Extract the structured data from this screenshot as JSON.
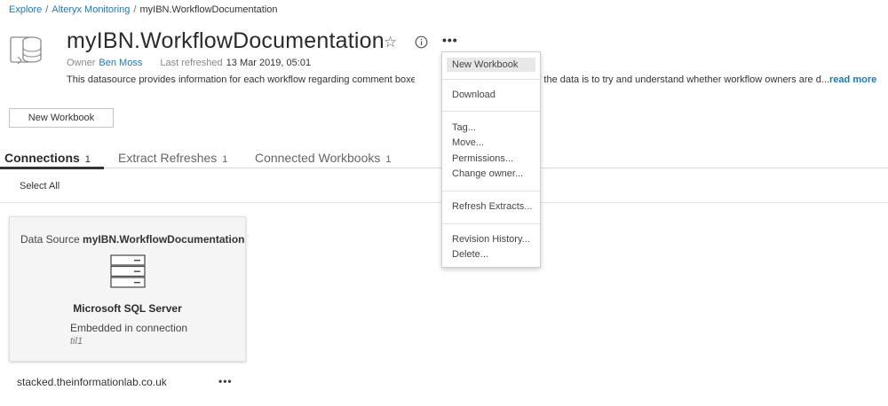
{
  "breadcrumb": {
    "items": [
      "Explore",
      "Alteryx Monitoring"
    ],
    "current": "myIBN.WorkflowDocumentation",
    "separator": "/"
  },
  "header": {
    "title": "myIBN.WorkflowDocumentation",
    "favorite_icon": "star-icon",
    "info_icon": "info-icon",
    "more_icon": "more-icon",
    "more_glyph": "•••",
    "owner_label": "Owner",
    "owner_name": "Ben Moss",
    "last_refreshed_label": "Last refreshed",
    "last_refreshed_value": "13 Mar 2019, 05:01",
    "description_part1": "This datasource provides information for each workflow regarding comment boxes that exi",
    "description_part2": "e of the data is to try and understand whether workflow owners are d...",
    "read_more": "read more"
  },
  "actions": {
    "new_workbook_label": "New Workbook"
  },
  "tabs": [
    {
      "label": "Connections",
      "count": "1",
      "active": true
    },
    {
      "label": "Extract Refreshes",
      "count": "1",
      "active": false
    },
    {
      "label": "Connected Workbooks",
      "count": "1",
      "active": false
    }
  ],
  "toolbar": {
    "select_all": "Select All"
  },
  "connection_card": {
    "prefix": "Data Source",
    "name": "myIBN.WorkflowDocumentation",
    "type": "Microsoft SQL Server",
    "auth": "Embedded in connection",
    "user": "til1",
    "server": "stacked.theinformationlab.co.uk",
    "more_glyph": "•••"
  },
  "menu": {
    "new_workbook": "New Workbook",
    "download": "Download",
    "tag": "Tag...",
    "move": "Move...",
    "permissions": "Permissions...",
    "change_owner": "Change owner...",
    "refresh_extracts": "Refresh Extracts...",
    "revision_history": "Revision History...",
    "delete": "Delete..."
  },
  "colors": {
    "link": "#1f77b4",
    "text": "#333333",
    "card_bg": "#f5f5f5",
    "menu_highlight": "#e8e8e8"
  }
}
